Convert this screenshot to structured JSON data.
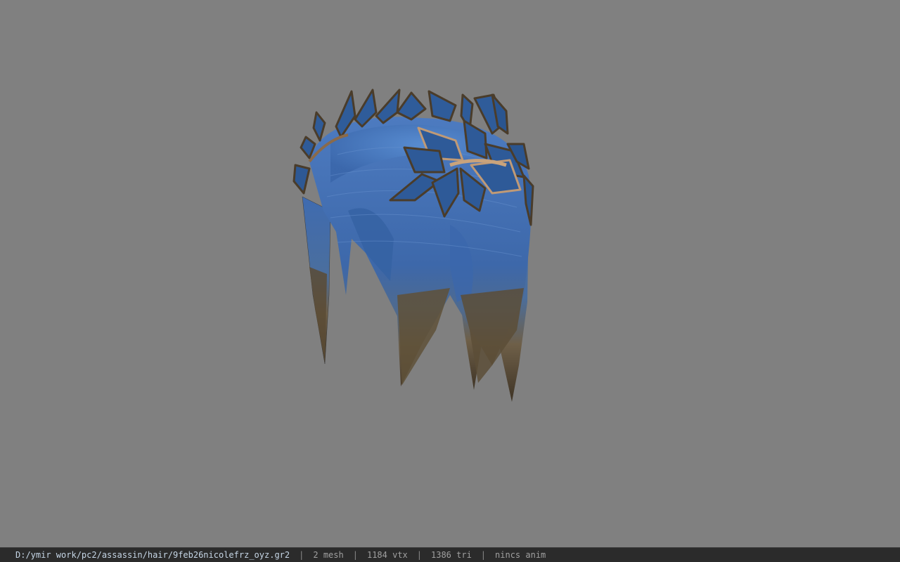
{
  "status_bar": {
    "file_path": "D:/ymir work/pc2/assassin/hair/9feb26nicolefrz_oyz.gr2",
    "separator": "|",
    "mesh_count": "2 mesh",
    "vertex_count": "1184 vtx",
    "triangle_count": "1386 tri",
    "animation": "nincs anim"
  },
  "viewport": {
    "background_color": "#808080",
    "model_name": "hair-with-leaf-crown"
  },
  "colors": {
    "hair_blue": "#3f6aaa",
    "hair_tip_brown": "#6a5a40",
    "leaf_blue": "#2f5a96",
    "leaf_rim": "#5a4a34",
    "status_bg": "#2b2b2b"
  }
}
